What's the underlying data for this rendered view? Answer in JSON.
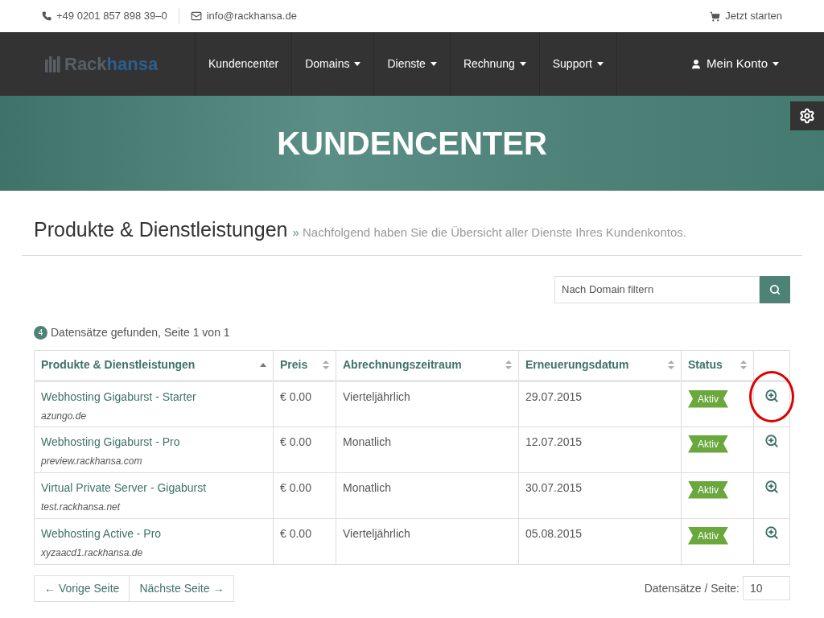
{
  "topbar": {
    "phone": "+49 0201 857 898 39–0",
    "email": "info@rackhansa.de",
    "cta": "Jetzt starten"
  },
  "nav": {
    "logo_a": "Rack",
    "logo_b": "hansa",
    "items": [
      {
        "label": "Kundencenter",
        "dropdown": false
      },
      {
        "label": "Domains",
        "dropdown": true
      },
      {
        "label": "Dienste",
        "dropdown": true
      },
      {
        "label": "Rechnung",
        "dropdown": true
      },
      {
        "label": "Support",
        "dropdown": true
      }
    ],
    "account": "Mein Konto"
  },
  "hero": {
    "title": "KUNDENCENTER"
  },
  "heading": {
    "title": "Produkte & Dienstleistungen",
    "separator": "»",
    "subtitle": "Nachfolgend haben Sie die Übersicht aller Dienste Ihres Kundenkontos."
  },
  "filter": {
    "placeholder": "Nach Domain filtern"
  },
  "summary": {
    "count": "4",
    "text": "Datensätze gefunden, Seite 1 von 1"
  },
  "table": {
    "columns": [
      {
        "label": "Produkte & Dienstleistungen",
        "sorted": true
      },
      {
        "label": "Preis",
        "sorted": false
      },
      {
        "label": "Abrechnungszeitraum",
        "sorted": false
      },
      {
        "label": "Erneuerungsdatum",
        "sorted": false
      },
      {
        "label": "Status",
        "sorted": false
      }
    ],
    "rows": [
      {
        "product": "Webhosting Gigaburst - Starter",
        "domain": "azungo.de",
        "price": "€ 0.00",
        "cycle": "Vierteljährlich",
        "date": "29.07.2015",
        "status": "Aktiv",
        "circled": true
      },
      {
        "product": "Webhosting Gigaburst - Pro",
        "domain": "preview.rackhansa.com",
        "price": "€ 0.00",
        "cycle": "Monatlich",
        "date": "12.07.2015",
        "status": "Aktiv",
        "circled": false
      },
      {
        "product": "Virtual Private Server - Gigaburst",
        "domain": "test.rackhansa.net",
        "price": "€ 0.00",
        "cycle": "Monatlich",
        "date": "30.07.2015",
        "status": "Aktiv",
        "circled": false
      },
      {
        "product": "Webhosting Active - Pro",
        "domain": "xyzaacd1.rackhansa.de",
        "price": "€ 0.00",
        "cycle": "Vierteljährlich",
        "date": "05.08.2015",
        "status": "Aktiv",
        "circled": false
      }
    ]
  },
  "pager": {
    "prev": "← Vorige Seite",
    "next": "Nächste Seite →",
    "per_page_label": "Datensätze / Seite:",
    "per_page": "10"
  }
}
